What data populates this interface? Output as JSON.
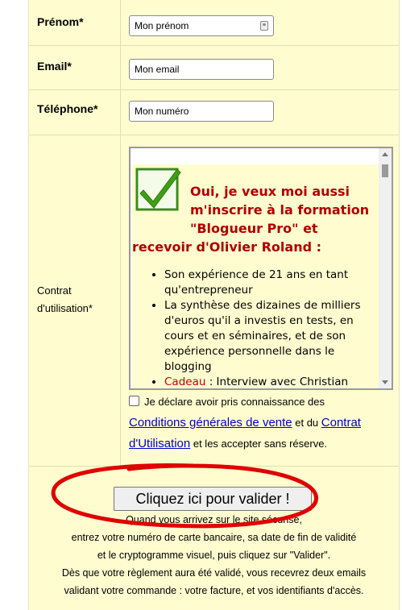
{
  "fields": {
    "prenom": {
      "label": "Prénom*",
      "placeholder": "Mon prénom"
    },
    "email": {
      "label": "Email*",
      "placeholder": "Mon email"
    },
    "telephone": {
      "label": "Téléphone*",
      "placeholder": "Mon numéro"
    }
  },
  "contract": {
    "label_line1": "Contrat",
    "label_line2": "d'utilisation*",
    "offer_title_line1": "Oui, je veux moi aussi m'inscrire à la formation \"Blogueur Pro\" et",
    "offer_title_line2": "recevoir d'Olivier Roland :",
    "benefits": [
      "Son expérience de 21 ans en tant qu'entrepreneur",
      "La synthèse des dizaines de milliers d'euros qu'il a investis en tests, en cours et en séminaires, et de son expérience personnelle dans le blogging"
    ],
    "gift_label": "Cadeau",
    "gift_text": " : Interview avec Christian"
  },
  "agreement": {
    "text_before": "Je déclare avoir pris connaissance des",
    "link_cgv": "Conditions générales de vente",
    "text_middle": " et du ",
    "link_contrat": "Contrat d'Utilisation",
    "text_after": " et les accepter sans réserve."
  },
  "submit": {
    "label": "Cliquez ici pour valider !"
  },
  "info_lines": [
    "Quand vous arrivez sur le site sécurisé,",
    "entrez votre numéro de carte bancaire, sa date de fin de validité",
    "et le cryptogramme visuel, puis cliquez sur \"Valider\".",
    "Dès que votre règlement aura été validé, vous recevrez deux emails",
    "validant votre commande : votre facture, et vos identifiants d'accès."
  ],
  "colors": {
    "form_bg": "#fffdd0",
    "title_red": "#b00000",
    "link_blue": "#0000cc",
    "annotation_red": "#e00000"
  }
}
